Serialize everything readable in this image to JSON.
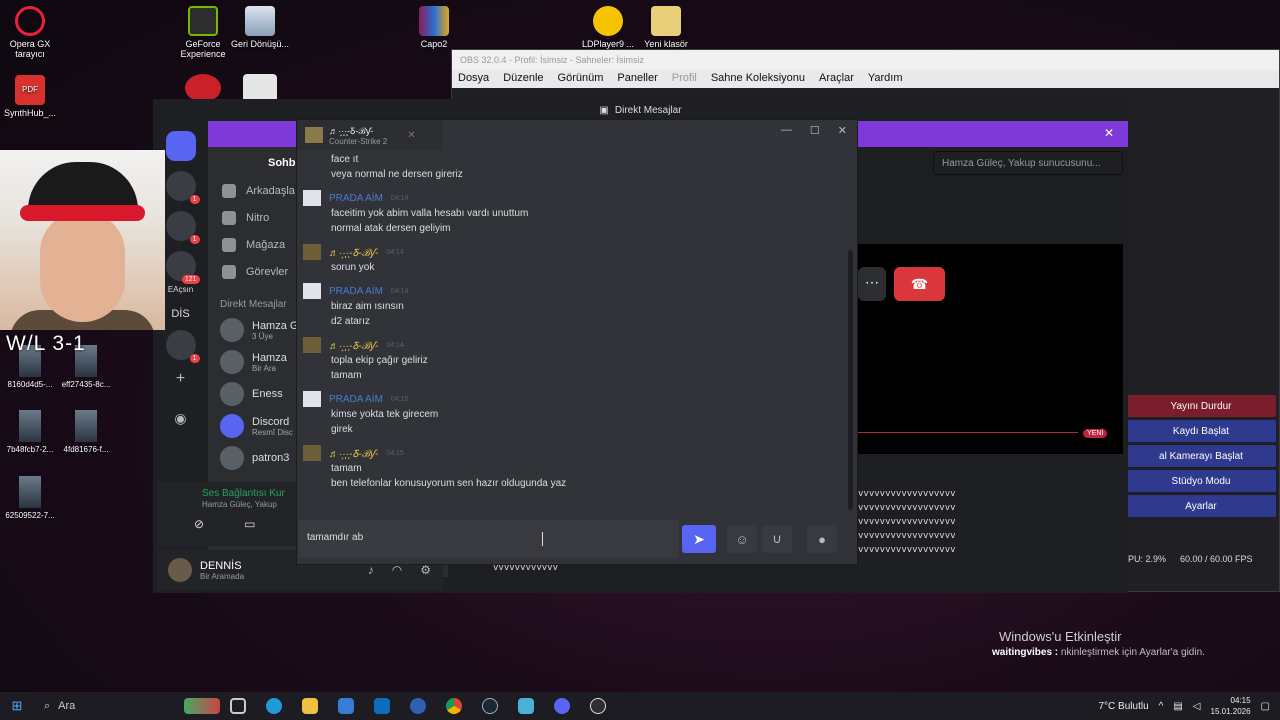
{
  "desktop": {
    "icons": [
      {
        "label": "Opera GX tarayıcı"
      },
      {
        "label": "SynthHub_..."
      },
      {
        "label": "GeForce Experience"
      },
      {
        "label": "Geri Dönüşü..."
      },
      {
        "label": "Capo2"
      },
      {
        "label": "LDPlayer9 ..."
      },
      {
        "label": "Yeni klasör"
      }
    ],
    "thumbs": [
      "8160d4d5-...",
      "eff27435-8c...",
      "7b48fcb7-2...",
      "4fd81676-f...",
      "62509522-7..."
    ],
    "overlay_text": "W/L 3-1"
  },
  "obs": {
    "title": "OBS 32.0.4 - Profil: İsimsiz - Sahneler: İsimsiz",
    "menu": [
      "Dosya",
      "Düzenle",
      "Görünüm",
      "Paneller",
      "Profil",
      "Sahne Koleksiyonu",
      "Araçlar",
      "Yardım"
    ],
    "controls": [
      "Yayını Durdur",
      "Kaydı Başlat",
      "al Kamerayı Başlat",
      "Stüdyo Modu",
      "Ayarlar"
    ],
    "status_cpu": "PU: 2.9%",
    "status_fps": "60.00 / 60.00 FPS",
    "badge": "YENİ"
  },
  "discord": {
    "window_title": "Direkt Mesajlar",
    "tab_chat": "Sohbe",
    "guild_label_dis": "DİS",
    "guild_label_eacsin": "EAçsın",
    "badges": [
      "1",
      "1",
      "121",
      "1"
    ],
    "nav": [
      {
        "label": "Arkadaşla"
      },
      {
        "label": "Nitro"
      },
      {
        "label": "Mağaza"
      },
      {
        "label": "Görevler"
      }
    ],
    "dm_header": "Direkt Mesajlar",
    "dms": [
      {
        "name": "Hamza G",
        "sub": "3 Üye"
      },
      {
        "name": "Hamza",
        "sub": "Bir Ara"
      },
      {
        "name": "Eness",
        "sub": ""
      },
      {
        "name": "Discord",
        "sub": "Resmî Disc"
      },
      {
        "name": "patron3",
        "sub": ""
      }
    ],
    "voice_status": "Ses Bağlantısı Kur",
    "voice_sub": "Hamza Güleç, Yakup",
    "user_name": "DENNİS",
    "user_status": "Bir Aramada",
    "search_placeholder": "Hamza Güleç, Yakup sunucusunu...",
    "stream_lines": [
      "vvvvvvvvvvvvvvvvvv",
      "vvvvvvvvvvvvvvvvvv",
      "vvvvvvvvvvvvvvvvvv",
      "vvvvvvvvvvvvvvvvvv",
      "vvvvvvvvvvvvvvvvvv"
    ],
    "stream_line_bottom": "vvvvvvvvvvvv"
  },
  "popout": {
    "tab_name": "♬·͙·̩̩·̩̩-Ᵹ-ℬƴ-",
    "tab_status": "Counter-Strike 2",
    "messages": [
      {
        "author": "",
        "time": "",
        "prada": false,
        "lines": [
          "face ıt",
          "veya normal ne dersen gireriz"
        ]
      },
      {
        "author": "PRADA AİM",
        "time": "04:14",
        "prada": true,
        "lines": [
          "faceitim yok abim valla hesabı vardı unuttum",
          "normal atak dersen geliyim"
        ]
      },
      {
        "author": "♬·͙·̩̩·̩̩-Ᵹ-ℬƴ-",
        "time": "04:14",
        "prada": false,
        "lines": [
          "sorun yok"
        ]
      },
      {
        "author": "PRADA AİM",
        "time": "04:14",
        "prada": true,
        "lines": [
          "biraz aim ısınsın",
          "d2 atarız"
        ]
      },
      {
        "author": "♬·͙·̩̩·̩̩-Ᵹ-ℬƴ-",
        "time": "04:14",
        "prada": false,
        "lines": [
          "topla ekip çağır geliriz",
          "tamam"
        ]
      },
      {
        "author": "PRADA AİM",
        "time": "04:15",
        "prada": true,
        "lines": [
          "kimse yokta tek girecem",
          "girek"
        ]
      },
      {
        "author": "♬·͙·̩̩·̩̩-Ᵹ-ℬƴ-",
        "time": "04:15",
        "prada": false,
        "lines": [
          "tamam",
          "ben telefonlar konusuyorum sen hazır oldugunda yaz"
        ]
      }
    ],
    "composer_value": "tamamdır ab"
  },
  "activation": {
    "title": "Windows'u Etkinleştir",
    "line_prefix": "waitingvibes :",
    "line_rest": "nkinleştirmek için Ayarlar'a gidin."
  },
  "taskbar": {
    "search_label": "Ara",
    "weather": "7°C Bulutlu",
    "time": "04:15",
    "date": "15.01.2026",
    "accent": "#5aa7ff"
  }
}
